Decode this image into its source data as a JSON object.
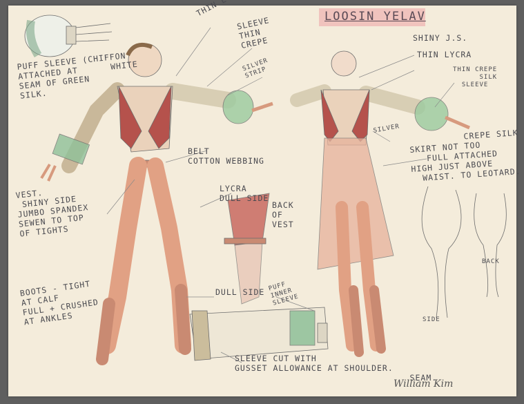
{
  "title": "LOOSIN YELAV",
  "signature": "William Kim",
  "notes": {
    "puff_sleeve": "PUFF SLEEVE (CHIFFON\nATTACHED AT      WHITE\nSEAM OF GREEN\nSILK.",
    "thin_lycra_left": "THIN LYCRA",
    "sleeve_thin_crepe": "SLEEVE\nTHIN\nCREPE",
    "silver_strip": "SILVER\nSTRIP",
    "shiny_js": "SHINY J.S.",
    "thin_lycra_right": "THIN LYCRA",
    "thin_crepe_silk_sleeve": "THIN CREPE\n      SILK\n  SLEEVE",
    "silver": "SILVER",
    "belt": "BELT\nCOTTON WEBBING",
    "crepe_silk_skirt": "          CREPE SILK\nSKIRT NOT TOO\n   FULL ATTACHED\nHIGH JUST ABOVE\n  WAIST. TO LEOTARD.",
    "vest": "VEST.\n SHINY SIDE\nJUMBO SPANDEX\nSEWEN TO TOP\nOF TIGHTS",
    "lycra_dull_side": "LYCRA\nDULL SIDE",
    "back_of_vest": "BACK\nOF\nVEST",
    "back": "BACK",
    "side": "SIDE",
    "boots": "BOOTS - TIGHT\nAT CALF\nFULL + CRUSHED\nAT ANKLES",
    "dull_side": "DULL SIDE",
    "puff_inner_sleeve": "PUFF\nINNER\nSLEEVE",
    "sleeve_cut": "SLEEVE CUT WITH\nGUSSET ALLOWANCE AT SHOULDER.\n                                SEAM."
  }
}
